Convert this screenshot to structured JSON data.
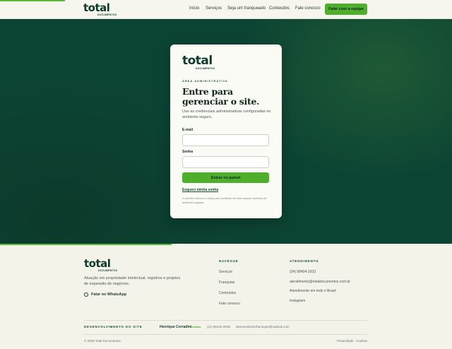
{
  "brand": {
    "word": "total",
    "sub": "DOCUMENTOS"
  },
  "nav": {
    "items": [
      "Início",
      "Serviços",
      "Seja um franqueado",
      "Conteúdos",
      "Fale conosco"
    ],
    "cta": "Falar com a equipe"
  },
  "login": {
    "eyebrow": "ÁREA ADMINISTRATIVA",
    "title_line1": "Entre para",
    "title_line2": "gerenciar o site.",
    "description": "Use as credenciais administrativas configuradas no ambiente seguro.",
    "email_label": "E-mail",
    "email_value": "",
    "password_label": "Senha",
    "password_value": "",
    "submit_label": "Entrar no painel",
    "forgot_label": "Esqueci minha senha",
    "fine_print": "O primeiro acesso é criado pelo conteúdo de ideal usando variáveis de ambiente seguras."
  },
  "footer": {
    "about": "Atuação em propriedade intelectual, registros e projetos de expansão de negócios.",
    "whatsapp": "Falar no WhatsApp",
    "navegue_title": "NAVEGUE",
    "navegue_items": [
      "Serviços",
      "Franquias",
      "Conteúdos",
      "Fale conosco"
    ],
    "atendimento_title": "ATENDIMENTO",
    "atendimento_items": [
      "(34) 98404-2933",
      "atendimento@totaldocumentos.com.br",
      "Atendimento em todo o Brasil",
      "Instagram"
    ],
    "dev_title": "DESENVOLVIMENTO DO SITE",
    "dev_name": "Henrique Corradini",
    "dev_role": "Portfólio",
    "dev_phone": "(11) 98142-2535",
    "dev_email": "desenvolvedorhenrique@outlook.com",
    "copyright": "© 2026 Total Documentos",
    "privacy": "Privacidade",
    "cookies": "Cookies"
  },
  "colors": {
    "accent": "#4fae2c",
    "hero": "#0c4434",
    "brand_dark": "#0e3b2e"
  }
}
